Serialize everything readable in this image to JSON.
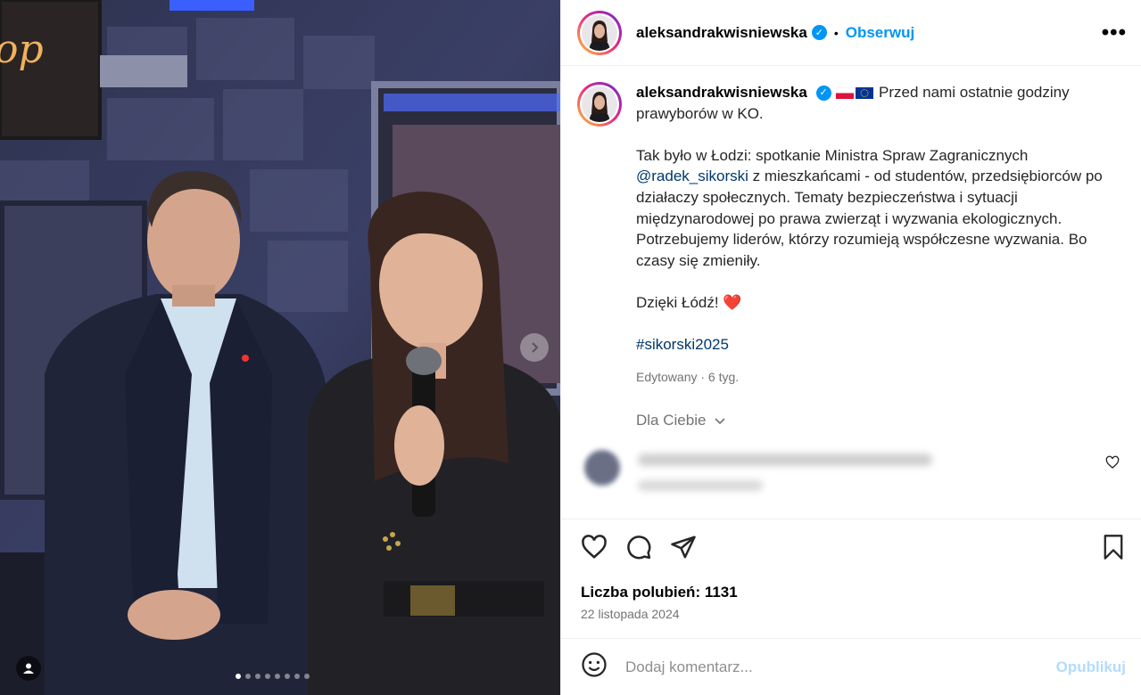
{
  "post": {
    "username": "aleksandrakwisniewska",
    "separator": "•",
    "follow_label": "Obserwuj",
    "more_label": "•••",
    "verified_mark": "✓",
    "caption_intro": "Przed nami ostatnie godziny prawyborów w KO.",
    "caption_p2_a": "Tak było w Łodzi: spotkanie Ministra Spraw Zagranicznych ",
    "mention": "@radek_sikorski",
    "caption_p2_b": " z mieszkańcami - od studentów, przedsiębiorców po działaczy społecznych. Tematy bezpieczeństwa i sytuacji międzynarodowej po prawa zwierząt i wyzwania ekologicznych. Potrzebujemy liderów, którzy rozumieją współczesne wyzwania. Bo czasy się zmieniły.",
    "caption_p3": "Dzięki Łódź! ",
    "heart_emoji": "❤️",
    "hashtag": "#sikorski2025",
    "edited": "Edytowany · 6 tyg.",
    "for_you": "Dla Ciebie",
    "likes": "Liczba polubień: 1131",
    "date": "22 listopada 2024",
    "comment_placeholder": "Dodaj komentarz...",
    "post_button": "Opublikuj"
  },
  "carousel": {
    "slide_count": 8,
    "active_index": 0
  },
  "colors": {
    "accent": "#0095f6",
    "link": "#00376b",
    "muted": "#737373",
    "post_disabled": "#b3dbff"
  },
  "icons": [
    "more-icon",
    "verified-icon",
    "flag-pl-icon",
    "flag-eu-icon",
    "chevron-down-icon",
    "heart-icon",
    "comment-icon",
    "share-icon",
    "bookmark-icon",
    "emoji-icon",
    "carousel-next-icon",
    "user-tag-icon"
  ]
}
